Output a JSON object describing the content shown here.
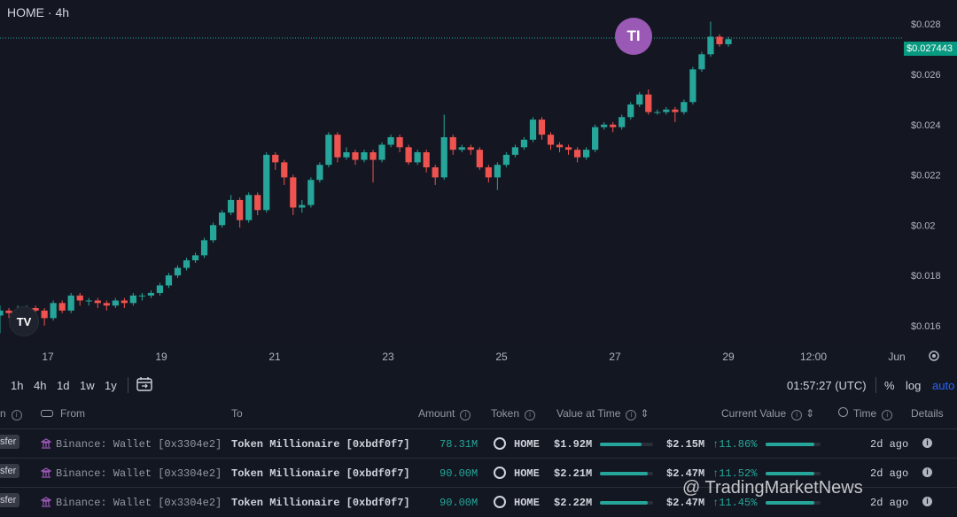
{
  "header": {
    "title": "HOME · 4h"
  },
  "chart": {
    "badge_text": "TI",
    "logo_text": "TV",
    "current_price_label": "$0.027443",
    "current_price": 0.027443,
    "price_axis_labels": [
      "$0.028",
      "$0.026",
      "$0.024",
      "$0.022",
      "$0.02",
      "$0.018",
      "$0.016"
    ],
    "price_axis_values": [
      0.028,
      0.026,
      0.024,
      0.022,
      0.02,
      0.018,
      0.016
    ],
    "time_axis_labels": [
      "17",
      "19",
      "21",
      "23",
      "25",
      "27",
      "29",
      "12:00",
      "Jun"
    ],
    "colors": {
      "up": "#26a69a",
      "down": "#ef5350",
      "badge": "#9b59b6"
    },
    "candles": [
      [
        0.0164,
        0.0166,
        0.0157,
        0.0168
      ],
      [
        0.0166,
        0.0165,
        0.0163,
        0.0167
      ],
      [
        0.0165,
        0.0166,
        0.0164,
        0.0168
      ],
      [
        0.0166,
        0.0167,
        0.0165,
        0.0168
      ],
      [
        0.0167,
        0.0166,
        0.0164,
        0.0168
      ],
      [
        0.0166,
        0.0163,
        0.016,
        0.0167
      ],
      [
        0.0163,
        0.0169,
        0.0162,
        0.017
      ],
      [
        0.0169,
        0.0166,
        0.0165,
        0.017
      ],
      [
        0.0166,
        0.0172,
        0.0165,
        0.0173
      ],
      [
        0.0172,
        0.017,
        0.0168,
        0.0173
      ],
      [
        0.017,
        0.017,
        0.0168,
        0.0171
      ],
      [
        0.017,
        0.0169,
        0.0167,
        0.0171
      ],
      [
        0.0169,
        0.0168,
        0.0166,
        0.017
      ],
      [
        0.0168,
        0.017,
        0.0167,
        0.0171
      ],
      [
        0.017,
        0.0169,
        0.0167,
        0.0171
      ],
      [
        0.0169,
        0.0172,
        0.0168,
        0.0173
      ],
      [
        0.0172,
        0.0172,
        0.017,
        0.0173
      ],
      [
        0.0172,
        0.0173,
        0.0171,
        0.0174
      ],
      [
        0.0173,
        0.0176,
        0.0172,
        0.0177
      ],
      [
        0.0176,
        0.018,
        0.0175,
        0.0181
      ],
      [
        0.018,
        0.0183,
        0.0179,
        0.0184
      ],
      [
        0.0183,
        0.0186,
        0.0182,
        0.0187
      ],
      [
        0.0186,
        0.0188,
        0.0185,
        0.0189
      ],
      [
        0.0188,
        0.0194,
        0.0187,
        0.0195
      ],
      [
        0.0194,
        0.02,
        0.0193,
        0.0201
      ],
      [
        0.02,
        0.0205,
        0.0199,
        0.0206
      ],
      [
        0.0205,
        0.021,
        0.0204,
        0.0212
      ],
      [
        0.021,
        0.0202,
        0.0199,
        0.0211
      ],
      [
        0.0202,
        0.0212,
        0.0201,
        0.0213
      ],
      [
        0.0212,
        0.0206,
        0.0204,
        0.0213
      ],
      [
        0.0206,
        0.0228,
        0.0205,
        0.0229
      ],
      [
        0.0228,
        0.0225,
        0.0222,
        0.0229
      ],
      [
        0.0225,
        0.0219,
        0.0216,
        0.0226
      ],
      [
        0.0219,
        0.0207,
        0.0204,
        0.022
      ],
      [
        0.0207,
        0.0208,
        0.0205,
        0.021
      ],
      [
        0.0208,
        0.0218,
        0.0207,
        0.0219
      ],
      [
        0.0218,
        0.0224,
        0.0217,
        0.0225
      ],
      [
        0.0224,
        0.0236,
        0.0223,
        0.0237
      ],
      [
        0.0236,
        0.0227,
        0.0225,
        0.0237
      ],
      [
        0.0227,
        0.0229,
        0.0226,
        0.0231
      ],
      [
        0.0229,
        0.0226,
        0.0224,
        0.023
      ],
      [
        0.0226,
        0.0229,
        0.0225,
        0.023
      ],
      [
        0.0229,
        0.0226,
        0.0217,
        0.023
      ],
      [
        0.0226,
        0.0232,
        0.0225,
        0.0233
      ],
      [
        0.0232,
        0.0235,
        0.0231,
        0.0236
      ],
      [
        0.0235,
        0.0231,
        0.0229,
        0.0236
      ],
      [
        0.0231,
        0.0225,
        0.0224,
        0.0232
      ],
      [
        0.0225,
        0.0229,
        0.0224,
        0.023
      ],
      [
        0.0229,
        0.0223,
        0.0221,
        0.023
      ],
      [
        0.0223,
        0.0219,
        0.0216,
        0.0224
      ],
      [
        0.0219,
        0.0235,
        0.0218,
        0.0244
      ],
      [
        0.0235,
        0.023,
        0.0228,
        0.0236
      ],
      [
        0.023,
        0.0231,
        0.0229,
        0.0232
      ],
      [
        0.0231,
        0.023,
        0.0228,
        0.0232
      ],
      [
        0.023,
        0.0223,
        0.0222,
        0.0231
      ],
      [
        0.0223,
        0.0219,
        0.0217,
        0.0224
      ],
      [
        0.0219,
        0.0224,
        0.0214,
        0.0225
      ],
      [
        0.0224,
        0.0228,
        0.0223,
        0.0229
      ],
      [
        0.0228,
        0.0231,
        0.0227,
        0.0232
      ],
      [
        0.0231,
        0.0234,
        0.023,
        0.0235
      ],
      [
        0.0234,
        0.0242,
        0.0233,
        0.0243
      ],
      [
        0.0242,
        0.0236,
        0.0234,
        0.0243
      ],
      [
        0.0236,
        0.0232,
        0.023,
        0.0237
      ],
      [
        0.0232,
        0.0231,
        0.0229,
        0.0233
      ],
      [
        0.0231,
        0.023,
        0.0228,
        0.0232
      ],
      [
        0.023,
        0.0227,
        0.0225,
        0.0231
      ],
      [
        0.0227,
        0.023,
        0.0226,
        0.0231
      ],
      [
        0.023,
        0.0239,
        0.0229,
        0.024
      ],
      [
        0.0239,
        0.024,
        0.0238,
        0.0241
      ],
      [
        0.024,
        0.0239,
        0.0237,
        0.0241
      ],
      [
        0.0239,
        0.0243,
        0.0238,
        0.0244
      ],
      [
        0.0243,
        0.0248,
        0.0242,
        0.0249
      ],
      [
        0.0248,
        0.0252,
        0.0247,
        0.0253
      ],
      [
        0.0252,
        0.0245,
        0.0244,
        0.0254
      ],
      [
        0.0245,
        0.0245,
        0.0244,
        0.0246
      ],
      [
        0.0245,
        0.0246,
        0.0244,
        0.0247
      ],
      [
        0.0246,
        0.0245,
        0.0241,
        0.0247
      ],
      [
        0.0245,
        0.0249,
        0.0244,
        0.025
      ],
      [
        0.0249,
        0.0262,
        0.0248,
        0.0263
      ],
      [
        0.0262,
        0.0268,
        0.0261,
        0.0269
      ],
      [
        0.0268,
        0.0275,
        0.0267,
        0.0281
      ],
      [
        0.0275,
        0.0272,
        0.0271,
        0.0276
      ],
      [
        0.0272,
        0.0274,
        0.0271,
        0.0275
      ]
    ]
  },
  "toolbar": {
    "timeframes": [
      "1h",
      "4h",
      "1d",
      "1w",
      "1y"
    ],
    "clock": "01:57:27 (UTC)",
    "percent": "%",
    "log": "log",
    "auto": "auto"
  },
  "table": {
    "headers": {
      "from": "From",
      "to": "To",
      "amount": "Amount",
      "token": "Token",
      "value_at_time": "Value at Time",
      "current_value": "Current Value",
      "time": "Time",
      "details": "Details"
    },
    "rows": [
      {
        "type": "sfer",
        "from": "Binance: Wallet [0x3304e2]",
        "to": "Token Millionaire [0xbdf0f7]",
        "amount": "78.31M",
        "token": "HOME",
        "value_at_time": "$1.92M",
        "value_bar": 0.78,
        "current_value": "$2.15M",
        "change": "↑11.86%",
        "change_bar": 0.88,
        "time": "2d ago"
      },
      {
        "type": "sfer",
        "from": "Binance: Wallet [0x3304e2]",
        "to": "Token Millionaire [0xbdf0f7]",
        "amount": "90.00M",
        "token": "HOME",
        "value_at_time": "$2.21M",
        "value_bar": 0.9,
        "current_value": "$2.47M",
        "change": "↑11.52%",
        "change_bar": 0.88,
        "time": "2d ago"
      },
      {
        "type": "sfer",
        "from": "Binance: Wallet [0x3304e2]",
        "to": "Token Millionaire [0xbdf0f7]",
        "amount": "90.00M",
        "token": "HOME",
        "value_at_time": "$2.22M",
        "value_bar": 0.9,
        "current_value": "$2.47M",
        "change": "↑11.45%",
        "change_bar": 0.88,
        "time": "2d ago"
      }
    ]
  },
  "watermark": "@ TradingMarketNews"
}
